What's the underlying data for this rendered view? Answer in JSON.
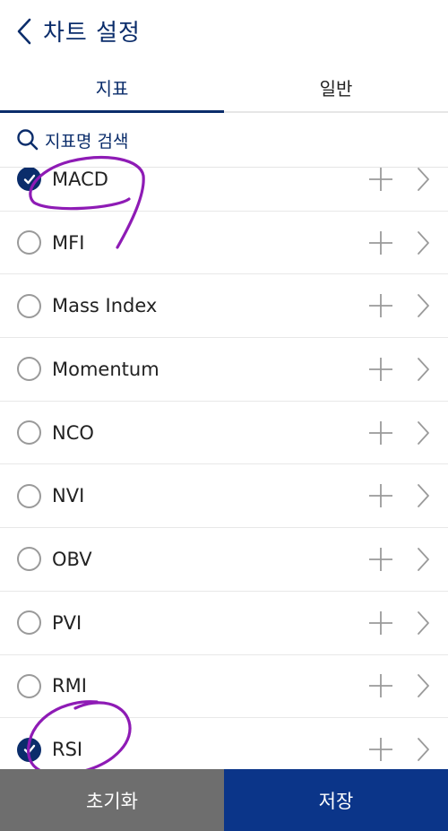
{
  "header": {
    "title": "차트 설정",
    "back_icon": "chevron-left-icon"
  },
  "tabs": [
    {
      "label": "지표",
      "active": true
    },
    {
      "label": "일반",
      "active": false
    }
  ],
  "search": {
    "label": "지표명 검색",
    "icon": "search-icon"
  },
  "indicators": [
    {
      "name": "MACD",
      "checked": true
    },
    {
      "name": "MFI",
      "checked": false
    },
    {
      "name": "Mass Index",
      "checked": false
    },
    {
      "name": "Momentum",
      "checked": false
    },
    {
      "name": "NCO",
      "checked": false
    },
    {
      "name": "NVI",
      "checked": false
    },
    {
      "name": "OBV",
      "checked": false
    },
    {
      "name": "PVI",
      "checked": false
    },
    {
      "name": "RMI",
      "checked": false
    },
    {
      "name": "RSI",
      "checked": true
    }
  ],
  "footer": {
    "reset_label": "초기화",
    "save_label": "저장"
  },
  "colors": {
    "primary": "#0b2d6b",
    "save_button": "#0b3589",
    "reset_button": "#6e6e6e",
    "annotation": "#8e1bb5"
  }
}
